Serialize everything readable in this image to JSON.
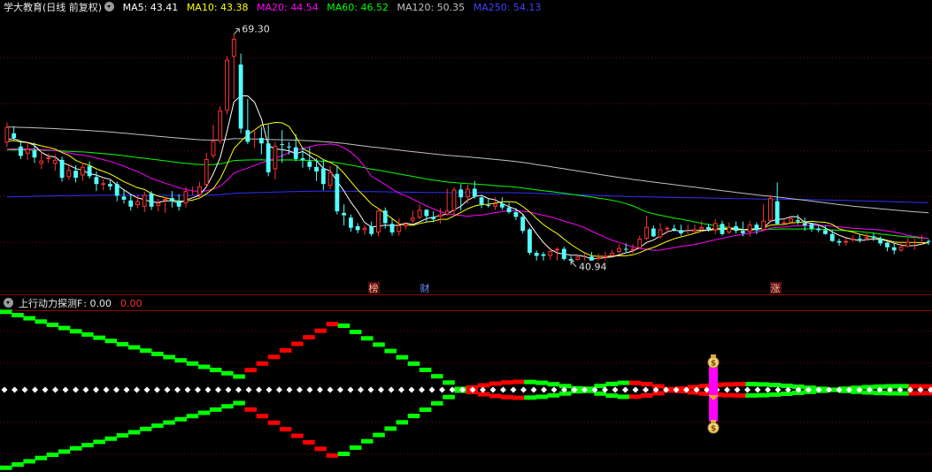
{
  "main_header": {
    "title": "学大教育(日线 前复权)",
    "ma5": "MA5: 43.41",
    "ma10": "MA10: 43.38",
    "ma20": "MA20: 44.54",
    "ma60": "MA60: 46.52",
    "ma120": "MA120: 50.35",
    "ma250": "MA250: 54.13"
  },
  "sub_header": {
    "title": "上行动力探测F",
    "value1": ": 0.00",
    "value2": "0.00"
  },
  "annotations": {
    "high": "69.30",
    "low": "40.94",
    "marker_bang": "榜",
    "marker_cai": "财",
    "marker_zhang": "涨"
  },
  "colors": {
    "bg": "#000000",
    "up": "#ff3232",
    "down": "#54ffff",
    "ma5": "#ffffff",
    "ma10": "#ffff00",
    "ma20": "#ff00ff",
    "ma60": "#00ff00",
    "ma120": "#c0c0c0",
    "ma250": "#3030ff",
    "osc_up": "#ff0000",
    "osc_down": "#00ff00",
    "signal": "#ff00ff"
  },
  "chart_data": [
    {
      "type": "candlestick",
      "title": "学大教育(日线 前复权)",
      "period": "daily",
      "ylim": [
        38.5,
        72
      ],
      "high_label": 69.3,
      "low_label": 40.94,
      "series": [
        {
          "name": "MA5",
          "last": 43.41
        },
        {
          "name": "MA10",
          "last": 43.38
        },
        {
          "name": "MA20",
          "last": 44.54
        },
        {
          "name": "MA60",
          "last": 46.52
        },
        {
          "name": "MA120",
          "last": 50.35
        },
        {
          "name": "MA250",
          "last": 54.13
        }
      ],
      "candles": [
        [
          56.0,
          58.0,
          58.6,
          55.4
        ],
        [
          57.2,
          56.6,
          58.1,
          56.2
        ],
        [
          55.5,
          54.3,
          56.2,
          53.9
        ],
        [
          54.6,
          55.2,
          55.9,
          53.8
        ],
        [
          55.0,
          54.1,
          56.0,
          53.4
        ],
        [
          53.3,
          53.7,
          54.9,
          52.6
        ],
        [
          53.9,
          54.1,
          54.6,
          53.4
        ],
        [
          53.3,
          53.8,
          54.5,
          52.4
        ],
        [
          53.8,
          51.5,
          54.2,
          51.0
        ],
        [
          51.6,
          52.5,
          53.3,
          51.2
        ],
        [
          52.4,
          51.5,
          53.1,
          50.9
        ],
        [
          51.8,
          52.9,
          53.4,
          51.1
        ],
        [
          53.0,
          51.7,
          53.6,
          51.4
        ],
        [
          51.6,
          50.7,
          52.3,
          49.8
        ],
        [
          50.6,
          50.8,
          51.3,
          49.9
        ],
        [
          50.7,
          50.4,
          51.2,
          49.9
        ],
        [
          50.7,
          49.2,
          51.0,
          48.5
        ],
        [
          49.1,
          48.7,
          50.0,
          48.2
        ],
        [
          48.6,
          47.8,
          49.4,
          47.3
        ],
        [
          48.0,
          48.5,
          49.3,
          47.6
        ],
        [
          47.8,
          49.3,
          49.7,
          47.1
        ],
        [
          49.5,
          47.8,
          49.8,
          47.4
        ],
        [
          47.9,
          48.3,
          48.8,
          47.2
        ],
        [
          48.6,
          48.8,
          49.0,
          47.0
        ],
        [
          48.9,
          48.5,
          49.8,
          47.7
        ],
        [
          48.6,
          47.8,
          49.4,
          47.3
        ],
        [
          48.2,
          49.8,
          50.3,
          47.7
        ],
        [
          49.7,
          49.8,
          50.4,
          49.3
        ],
        [
          49.3,
          50.4,
          51.0,
          48.9
        ],
        [
          50.6,
          53.9,
          54.7,
          50.4
        ],
        [
          54.3,
          56.2,
          58.3,
          54.0
        ],
        [
          56.2,
          60.1,
          60.7,
          55.9
        ],
        [
          60.1,
          66.6,
          67.1,
          59.6
        ],
        [
          67.0,
          69.3,
          69.9,
          61.6
        ],
        [
          66.0,
          57.8,
          67.4,
          57.2
        ],
        [
          57.6,
          56.1,
          61.6,
          55.8
        ],
        [
          56.1,
          56.1,
          57.7,
          55.3
        ],
        [
          56.6,
          55.9,
          58.0,
          54.5
        ],
        [
          55.9,
          52.2,
          58.3,
          51.7
        ],
        [
          52.6,
          55.6,
          56.1,
          51.3
        ],
        [
          55.8,
          55.7,
          57.6,
          53.4
        ],
        [
          55.5,
          55.4,
          56.1,
          54.5
        ],
        [
          55.4,
          53.9,
          57.1,
          53.6
        ],
        [
          54.0,
          53.8,
          55.4,
          52.8
        ],
        [
          53.6,
          52.9,
          55.4,
          52.5
        ],
        [
          52.9,
          52.3,
          54.0,
          51.1
        ],
        [
          52.7,
          50.7,
          53.9,
          49.9
        ],
        [
          50.5,
          52.2,
          53.0,
          50.0
        ],
        [
          52.0,
          47.2,
          53.1,
          46.8
        ],
        [
          47.0,
          46.7,
          48.1,
          45.4
        ],
        [
          46.4,
          45.1,
          46.8,
          44.6
        ],
        [
          45.3,
          44.8,
          45.7,
          44.4
        ],
        [
          44.8,
          45.1,
          45.5,
          44.2
        ],
        [
          45.3,
          44.3,
          45.9,
          44.0
        ],
        [
          44.5,
          47.3,
          47.6,
          44.0
        ],
        [
          47.3,
          45.7,
          47.7,
          45.0
        ],
        [
          45.6,
          44.5,
          46.3,
          44.1
        ],
        [
          44.6,
          45.4,
          46.3,
          44.1
        ],
        [
          45.3,
          45.6,
          45.8,
          44.9
        ],
        [
          46.0,
          46.4,
          47.3,
          45.7
        ],
        [
          46.4,
          47.4,
          48.1,
          46.2
        ],
        [
          47.4,
          46.6,
          47.5,
          45.8
        ],
        [
          46.5,
          46.2,
          47.2,
          45.8
        ],
        [
          46.5,
          46.8,
          47.6,
          45.6
        ],
        [
          46.8,
          47.3,
          50.1,
          46.6
        ],
        [
          47.3,
          50.0,
          50.3,
          46.6
        ],
        [
          50.0,
          49.0,
          50.7,
          47.3
        ],
        [
          49.0,
          50.1,
          50.6,
          48.2
        ],
        [
          50.1,
          49.1,
          51.1,
          48.8
        ],
        [
          49.0,
          48.1,
          49.3,
          47.6
        ],
        [
          48.0,
          47.9,
          48.8,
          47.7
        ],
        [
          47.8,
          48.2,
          49.0,
          47.4
        ],
        [
          48.2,
          47.7,
          49.0,
          47.4
        ],
        [
          47.7,
          47.1,
          48.3,
          46.9
        ],
        [
          47.1,
          46.5,
          47.6,
          46.1
        ],
        [
          46.5,
          44.7,
          46.8,
          44.4
        ],
        [
          44.9,
          41.9,
          45.1,
          41.6
        ],
        [
          41.9,
          41.5,
          42.2,
          40.9
        ],
        [
          41.7,
          41.5,
          42.0,
          40.9
        ],
        [
          41.5,
          42.1,
          42.6,
          41.0
        ],
        [
          42.2,
          42.4,
          42.6,
          40.9
        ],
        [
          42.4,
          41.1,
          42.7,
          40.9
        ],
        [
          41.1,
          40.9,
          41.5,
          40.8
        ],
        [
          41.0,
          41.4,
          41.6,
          40.9
        ],
        [
          41.2,
          41.3,
          41.8,
          40.9
        ],
        [
          41.4,
          40.9,
          42.0,
          40.9
        ],
        [
          41.1,
          41.3,
          41.8,
          40.9
        ],
        [
          41.3,
          41.5,
          42.0,
          40.9
        ],
        [
          41.5,
          41.9,
          42.3,
          41.4
        ],
        [
          42.0,
          42.5,
          43.0,
          41.8
        ],
        [
          42.4,
          42.3,
          43.1,
          42.0
        ],
        [
          42.2,
          42.4,
          43.0,
          41.8
        ],
        [
          42.5,
          43.7,
          44.1,
          42.4
        ],
        [
          43.7,
          45.2,
          46.6,
          43.5
        ],
        [
          45.0,
          44.0,
          45.4,
          43.9
        ],
        [
          43.9,
          44.9,
          45.7,
          43.7
        ],
        [
          44.9,
          45.1,
          45.3,
          44.4
        ],
        [
          45.0,
          44.8,
          45.5,
          44.6
        ],
        [
          44.8,
          44.4,
          45.5,
          44.1
        ],
        [
          44.5,
          44.6,
          45.5,
          44.1
        ],
        [
          44.6,
          44.9,
          45.5,
          44.5
        ],
        [
          44.9,
          45.2,
          46.0,
          44.7
        ],
        [
          45.2,
          44.9,
          45.6,
          44.6
        ],
        [
          44.8,
          45.7,
          46.2,
          44.3
        ],
        [
          45.6,
          44.3,
          46.0,
          44.1
        ],
        [
          44.5,
          45.2,
          45.8,
          44.3
        ],
        [
          45.3,
          44.7,
          45.9,
          44.4
        ],
        [
          44.7,
          44.4,
          45.9,
          44.0
        ],
        [
          44.6,
          45.5,
          46.0,
          44.0
        ],
        [
          45.5,
          44.8,
          45.8,
          44.3
        ],
        [
          44.8,
          46.0,
          48.1,
          44.7
        ],
        [
          46.0,
          48.9,
          49.3,
          45.9
        ],
        [
          48.5,
          45.6,
          50.9,
          45.5
        ],
        [
          45.6,
          45.8,
          46.4,
          45.5
        ],
        [
          45.8,
          46.3,
          46.5,
          45.7
        ],
        [
          46.1,
          45.9,
          46.8,
          45.5
        ],
        [
          45.7,
          45.4,
          46.4,
          44.7
        ],
        [
          45.6,
          45.0,
          45.7,
          44.6
        ],
        [
          45.0,
          44.8,
          45.3,
          44.5
        ],
        [
          44.8,
          44.3,
          45.4,
          44.2
        ],
        [
          44.3,
          43.4,
          44.8,
          43.3
        ],
        [
          43.4,
          43.2,
          43.7,
          42.8
        ],
        [
          43.2,
          43.4,
          43.8,
          42.8
        ],
        [
          43.5,
          43.7,
          44.1,
          43.3
        ],
        [
          43.7,
          43.6,
          44.2,
          43.2
        ],
        [
          43.7,
          43.9,
          44.4,
          43.5
        ],
        [
          44.0,
          43.8,
          44.4,
          43.4
        ],
        [
          43.7,
          43.1,
          44.0,
          42.8
        ],
        [
          43.2,
          42.6,
          43.3,
          42.1
        ],
        [
          42.6,
          42.2,
          43.1,
          41.7
        ],
        [
          42.2,
          42.7,
          43.1,
          42.0
        ],
        [
          42.7,
          43.3,
          43.8,
          42.6
        ],
        [
          43.3,
          43.4,
          43.7,
          42.3
        ],
        [
          43.4,
          43.4,
          44.2,
          43.0
        ],
        [
          43.4,
          43.3,
          43.6,
          42.9
        ]
      ]
    },
    {
      "type": "line",
      "title": "上行动力探测F",
      "ylim": [
        -1,
        1
      ],
      "values_label": "0.00",
      "note": "mirrored step oscillator, red when rising, green when falling"
    }
  ]
}
